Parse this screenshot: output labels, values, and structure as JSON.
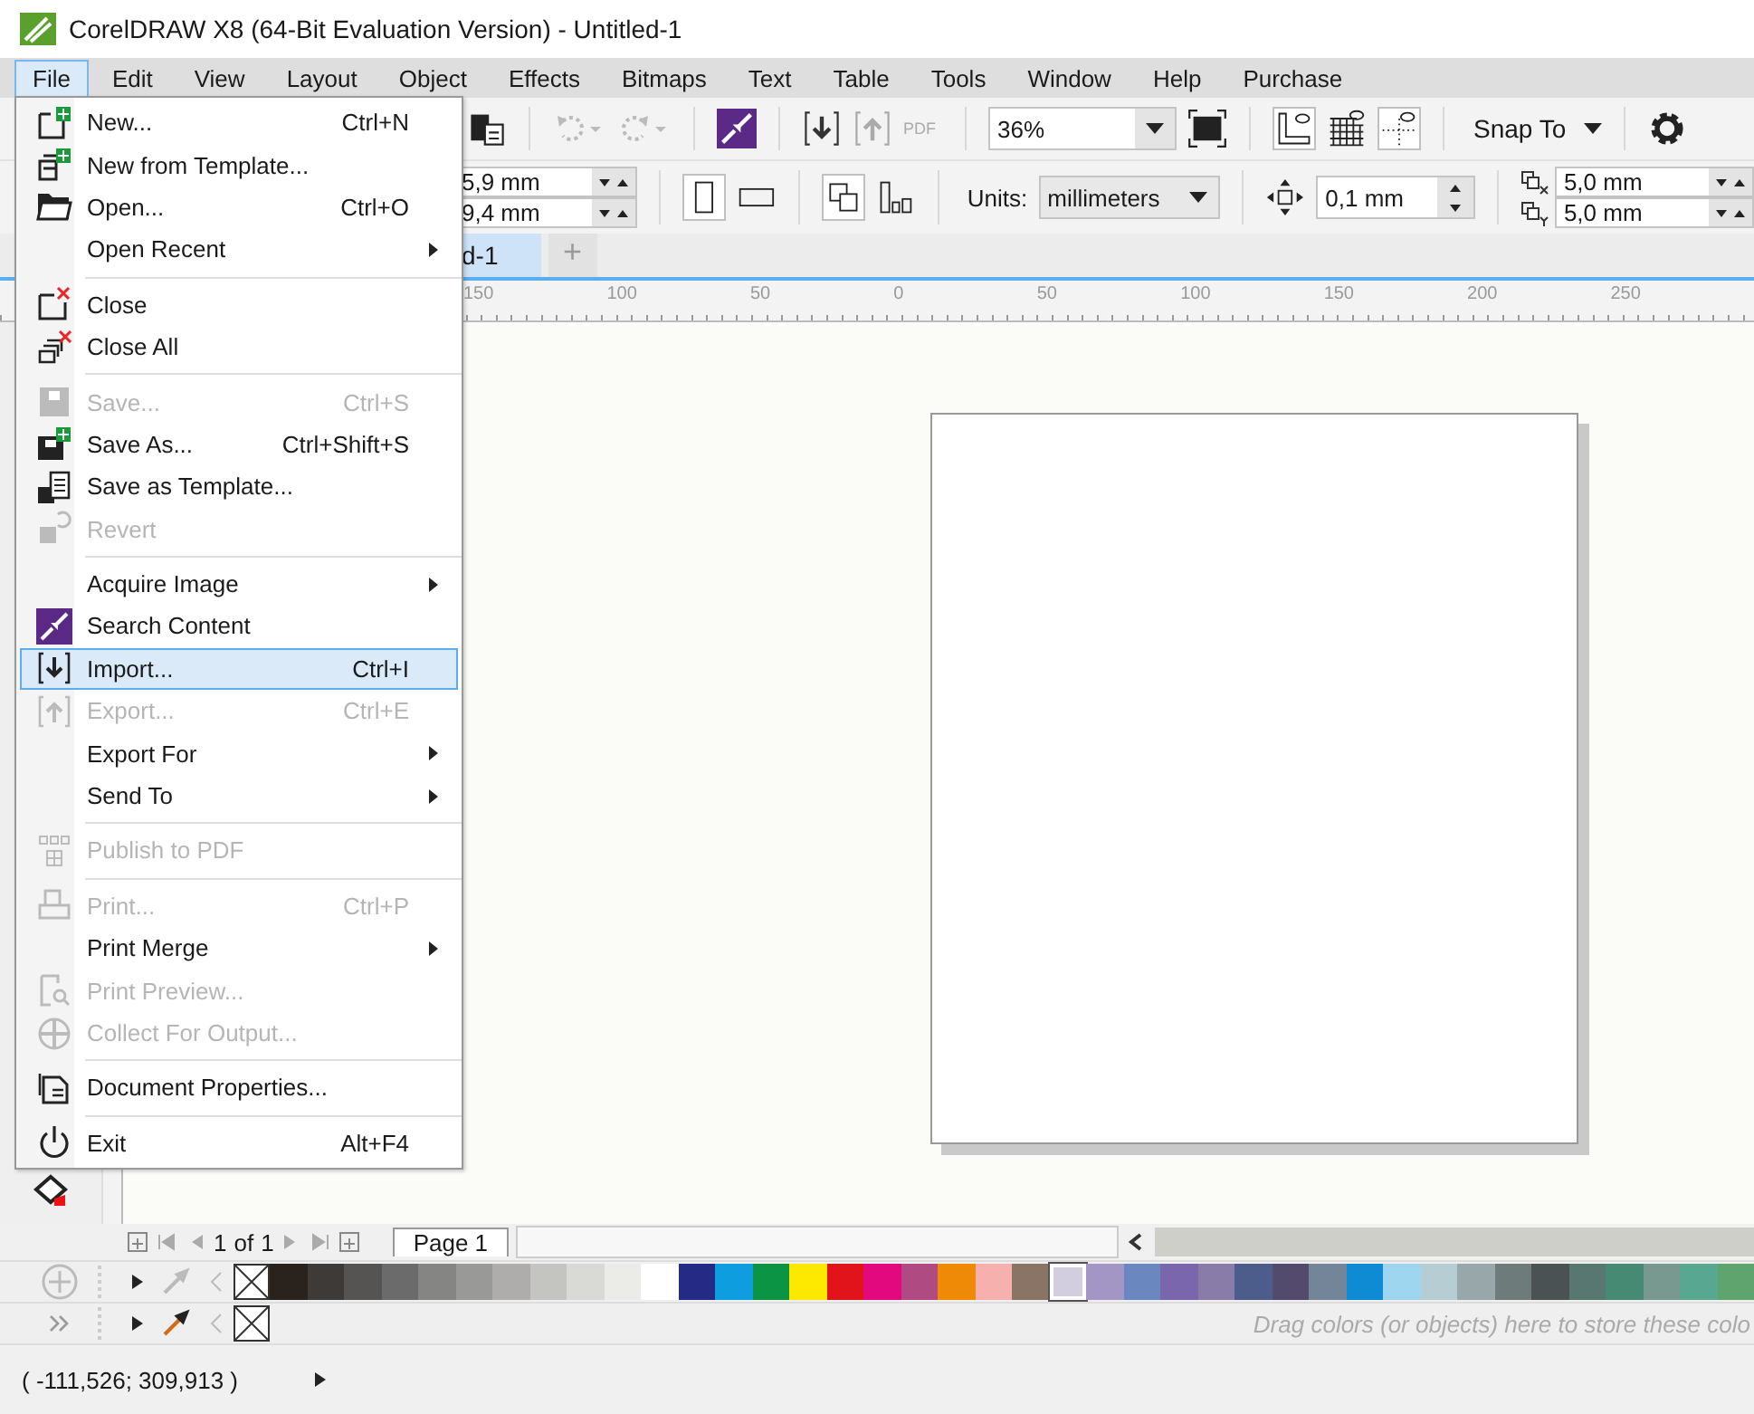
{
  "window": {
    "title": "CorelDRAW X8 (64-Bit Evaluation Version) - Untitled-1"
  },
  "menubar": [
    {
      "label": "File",
      "selected": true
    },
    {
      "label": "Edit",
      "selected": false
    },
    {
      "label": "View",
      "selected": false
    },
    {
      "label": "Layout",
      "selected": false
    },
    {
      "label": "Object",
      "selected": false
    },
    {
      "label": "Effects",
      "selected": false
    },
    {
      "label": "Bitmaps",
      "selected": false
    },
    {
      "label": "Text",
      "selected": false
    },
    {
      "label": "Table",
      "selected": false
    },
    {
      "label": "Tools",
      "selected": false
    },
    {
      "label": "Window",
      "selected": false
    },
    {
      "label": "Help",
      "selected": false
    },
    {
      "label": "Purchase",
      "selected": false
    }
  ],
  "file_menu": [
    {
      "kind": "item",
      "label": "New...",
      "shortcut": "Ctrl+N",
      "disabled": false,
      "submenu": false,
      "selected": false
    },
    {
      "kind": "item",
      "label": "New from Template...",
      "disabled": false,
      "submenu": false,
      "selected": false
    },
    {
      "kind": "item",
      "label": "Open...",
      "shortcut": "Ctrl+O",
      "disabled": false,
      "submenu": false,
      "selected": false
    },
    {
      "kind": "item",
      "label": "Open Recent",
      "disabled": false,
      "submenu": true,
      "selected": false
    },
    {
      "kind": "separator"
    },
    {
      "kind": "item",
      "label": "Close",
      "disabled": false,
      "submenu": false,
      "selected": false
    },
    {
      "kind": "item",
      "label": "Close All",
      "disabled": false,
      "submenu": false,
      "selected": false
    },
    {
      "kind": "separator"
    },
    {
      "kind": "item",
      "label": "Save...",
      "shortcut": "Ctrl+S",
      "disabled": true,
      "submenu": false,
      "selected": false
    },
    {
      "kind": "item",
      "label": "Save As...",
      "shortcut": "Ctrl+Shift+S",
      "disabled": false,
      "submenu": false,
      "selected": false
    },
    {
      "kind": "item",
      "label": "Save as Template...",
      "disabled": false,
      "submenu": false,
      "selected": false
    },
    {
      "kind": "item",
      "label": "Revert",
      "disabled": true,
      "submenu": false,
      "selected": false
    },
    {
      "kind": "separator"
    },
    {
      "kind": "item",
      "label": "Acquire Image",
      "disabled": false,
      "submenu": true,
      "selected": false
    },
    {
      "kind": "item",
      "label": "Search Content",
      "disabled": false,
      "submenu": false,
      "selected": false
    },
    {
      "kind": "item",
      "label": "Import...",
      "shortcut": "Ctrl+I",
      "disabled": false,
      "submenu": false,
      "selected": true
    },
    {
      "kind": "item",
      "label": "Export...",
      "shortcut": "Ctrl+E",
      "disabled": true,
      "submenu": false,
      "selected": false
    },
    {
      "kind": "item",
      "label": "Export For",
      "disabled": false,
      "submenu": true,
      "selected": false
    },
    {
      "kind": "item",
      "label": "Send To",
      "disabled": false,
      "submenu": true,
      "selected": false
    },
    {
      "kind": "separator"
    },
    {
      "kind": "item",
      "label": "Publish to PDF",
      "disabled": true,
      "submenu": false,
      "selected": false
    },
    {
      "kind": "separator"
    },
    {
      "kind": "item",
      "label": "Print...",
      "shortcut": "Ctrl+P",
      "disabled": true,
      "submenu": false,
      "selected": false
    },
    {
      "kind": "item",
      "label": "Print Merge",
      "disabled": false,
      "submenu": true,
      "selected": false
    },
    {
      "kind": "item",
      "label": "Print Preview...",
      "disabled": true,
      "submenu": false,
      "selected": false
    },
    {
      "kind": "item",
      "label": "Collect For Output...",
      "disabled": true,
      "submenu": false,
      "selected": false
    },
    {
      "kind": "separator"
    },
    {
      "kind": "item",
      "label": "Document Properties...",
      "disabled": false,
      "submenu": false,
      "selected": false
    },
    {
      "kind": "separator"
    },
    {
      "kind": "item",
      "label": "Exit",
      "shortcut": "Alt+F4",
      "disabled": false,
      "submenu": false,
      "selected": false
    }
  ],
  "toolbar": {
    "pdf_label": "PDF",
    "zoom": "36%",
    "snap": "Snap To"
  },
  "property_bar": {
    "width": "5,9 mm",
    "height": "9,4 mm",
    "units_label": "Units:",
    "units": "millimeters",
    "nudge": "0,1 mm",
    "dup_x": "5,0 mm",
    "dup_y": "5,0 mm"
  },
  "doc_tab": {
    "label": "d-1",
    "add": "+"
  },
  "ruler": [
    "150",
    "100",
    "50",
    "0",
    "50",
    "100",
    "150",
    "200",
    "250"
  ],
  "page_nav": {
    "current": "1",
    "of": "of",
    "total": "1",
    "page_tab": "Page 1"
  },
  "palette": [
    {
      "color": "#2a221c",
      "selected": false
    },
    {
      "color": "#3e3a37",
      "selected": false
    },
    {
      "color": "#565453",
      "selected": false
    },
    {
      "color": "#6b6b6b",
      "selected": false
    },
    {
      "color": "#858583",
      "selected": false
    },
    {
      "color": "#999998",
      "selected": false
    },
    {
      "color": "#aeadac",
      "selected": false
    },
    {
      "color": "#c4c4c0",
      "selected": false
    },
    {
      "color": "#d9d9d5",
      "selected": false
    },
    {
      "color": "#ebebe8",
      "selected": false
    },
    {
      "color": "#ffffff",
      "selected": false
    },
    {
      "color": "#252a84",
      "selected": false
    },
    {
      "color": "#0e9ee0",
      "selected": false
    },
    {
      "color": "#0b9444",
      "selected": false
    },
    {
      "color": "#fde800",
      "selected": false
    },
    {
      "color": "#e1141b",
      "selected": false
    },
    {
      "color": "#e2097f",
      "selected": false
    },
    {
      "color": "#b04a82",
      "selected": false
    },
    {
      "color": "#ef8a06",
      "selected": false
    },
    {
      "color": "#f6b1ae",
      "selected": false
    },
    {
      "color": "#8a7465",
      "selected": false
    },
    {
      "color": "#d2cee0",
      "selected": true
    },
    {
      "color": "#a396c5",
      "selected": false
    },
    {
      "color": "#6b87bf",
      "selected": false
    },
    {
      "color": "#7966ad",
      "selected": false
    },
    {
      "color": "#8a7ca9",
      "selected": false
    },
    {
      "color": "#4c5d8c",
      "selected": false
    },
    {
      "color": "#524b6e",
      "selected": false
    },
    {
      "color": "#748599",
      "selected": false
    },
    {
      "color": "#0e8bd2",
      "selected": false
    },
    {
      "color": "#9ed6ef",
      "selected": false
    },
    {
      "color": "#b6cdd4",
      "selected": false
    },
    {
      "color": "#98a7aa",
      "selected": false
    },
    {
      "color": "#6d7b7b",
      "selected": false
    },
    {
      "color": "#4a5254",
      "selected": false
    },
    {
      "color": "#577770",
      "selected": false
    },
    {
      "color": "#468a74",
      "selected": false
    },
    {
      "color": "#77998f",
      "selected": false
    },
    {
      "color": "#58a891",
      "selected": false
    },
    {
      "color": "#5fa46e",
      "selected": false
    }
  ],
  "document_palette_hint": "Drag colors (or objects) here to store these colo",
  "status_bar": {
    "coordinates": "( -111,526; 309,913 )"
  }
}
